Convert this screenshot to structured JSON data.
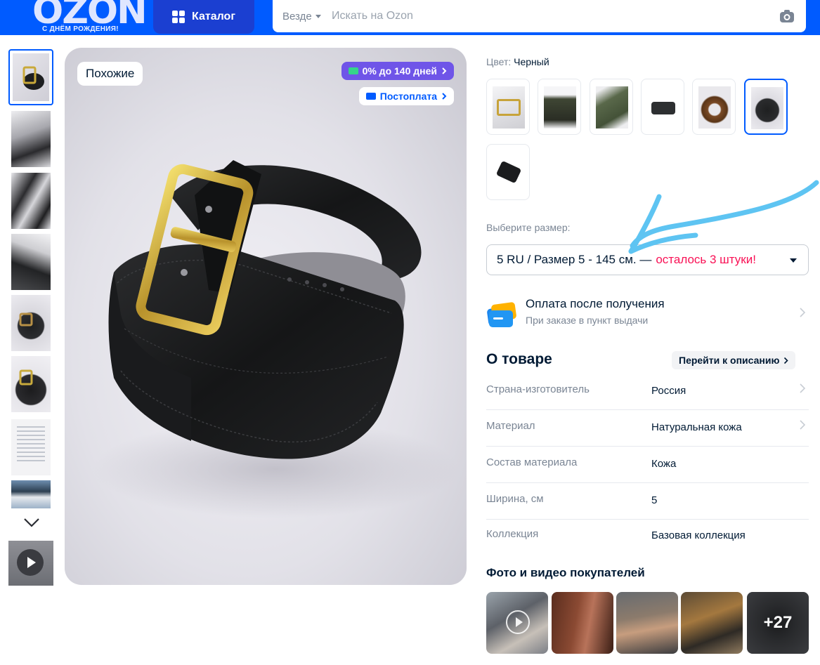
{
  "header": {
    "logo": "OZON",
    "logo_sub": "С ДНЁМ РОЖДЕНИЯ!",
    "catalog_label": "Каталог",
    "search_scope": "Везде",
    "search_placeholder": "Искать на Ozon",
    "brand_color": "#005bff"
  },
  "gallery": {
    "similar_label": "Похожие",
    "badge_installment": "0% до 140 дней",
    "badge_postpay": "Постоплата",
    "thumbnail_count": 8,
    "selected_thumbnail": 1
  },
  "product": {
    "color_label": "Цвет:",
    "color_value": "Черный",
    "selected_color_index": 6,
    "size_label": "Выберите размер:",
    "size_value": "5 RU / Размер 5 - 145 см. —",
    "size_stock": "осталось 3 штуки!",
    "stock_color": "#f91155"
  },
  "payment": {
    "title": "Оплата после получения",
    "subtitle": "При заказе в пункт выдачи"
  },
  "about": {
    "title": "О товаре",
    "link": "Перейти к описанию",
    "specs": [
      {
        "key": "Страна-изготовитель",
        "value": "Россия"
      },
      {
        "key": "Материал",
        "value": "Натуральная кожа"
      },
      {
        "key": "Состав материала",
        "value": "Кожа"
      },
      {
        "key": "Ширина, см",
        "value": "5"
      },
      {
        "key": "Коллекция",
        "value": "Базовая коллекция"
      }
    ]
  },
  "customer_media": {
    "title": "Фото и видео покупателей",
    "more_count": "+27"
  }
}
